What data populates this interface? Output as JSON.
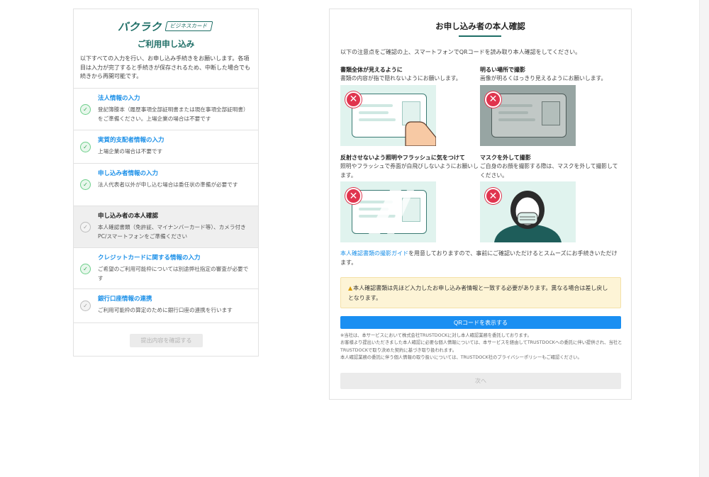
{
  "brand": {
    "logo_main": "バクラク",
    "logo_sub": "ビジネスカード"
  },
  "left": {
    "title": "ご利用申し込み",
    "intro": "以下すべての入力を行い、お申し込み手続きをお願いします。各項目は入力が完了すると手続きが保存されるため、中断した場合でも続きから再開可能です。",
    "steps": [
      {
        "title": "法人情報の入力",
        "desc": "登記簿謄本（履歴事項全部証明書または現在事項全部証明書）をご準備ください。上場企業の場合は不要です",
        "status": "done"
      },
      {
        "title": "実質的支配者情報の入力",
        "desc": "上場企業の場合は不要です",
        "status": "done"
      },
      {
        "title": "申し込み者情報の入力",
        "desc": "法人代表者以外が申し込む場合は委任状の準備が必要です",
        "status": "done"
      },
      {
        "title": "申し込み者の本人確認",
        "desc": "本人確認書類（免許証、マイナンバーカード等）、カメラ付きPC/スマートフォンをご準備ください",
        "status": "active"
      },
      {
        "title": "クレジットカードに関する情報の入力",
        "desc": "ご希望のご利用可能枠については別途弊社指定の審査が必要です",
        "status": "done"
      },
      {
        "title": "銀行口座情報の連携",
        "desc": "ご利用可能枠の算定のために銀行口座の連携を行います",
        "status": "todo"
      }
    ],
    "submit_label": "提出内容を確認する"
  },
  "right": {
    "title": "お申し込み者の本人確認",
    "intro": "以下の注意点をご確認の上、スマートフォンでQRコードを読み取り本人確認をしてください。",
    "tips": [
      {
        "title": "書類全体が見えるように",
        "desc": "書類の内容が指で隠れないようにお願いします。"
      },
      {
        "title": "明るい場所で撮影",
        "desc": "画像が明るくはっきり見えるようにお願いします。"
      },
      {
        "title": "反射させないよう照明やフラッシュに気をつけて",
        "desc": "照明やフラッシュで券面が白飛びしないようにお願いします。"
      },
      {
        "title": "マスクを外して撮影",
        "desc": "ご自身のお顔を撮影する際は、マスクを外して撮影してください。"
      }
    ],
    "guide_link": "本人確認書類の撮影ガイド",
    "guide_text": "を用意しておりますので、事前にご確認いただけるとスムーズにお手続きいただけます。",
    "warning": "本人確認書類は先ほど入力したお申し込み者情報と一致する必要があります。異なる場合は差し戻しとなります。",
    "qr_label": "QRコードを表示する",
    "notice": [
      "※当社は、本サービスにおいて株式会社TRUSTDOCKに対し本人確認業務を委託しております。",
      "お客様より提出いただきました本人確認に必要な個人情報については、本サービスを経由してTRUSTDOCKへの委託に伴い提供され、当社とTRUSTDOCKで取り決めた契約に基づき取り扱われます。",
      "本人確認業務の委託に伴う個人情報の取り扱いについては、TRUSTDOCK社のプライバシーポリシーもご確認ください。"
    ],
    "next_label": "次へ"
  },
  "colors": {
    "brand": "#1e6e66",
    "link": "#1a8fe8",
    "primary_button": "#1a8ff2",
    "error_badge": "#e0344e",
    "warning_bg": "#fdf4d6",
    "success": "#34a853"
  }
}
